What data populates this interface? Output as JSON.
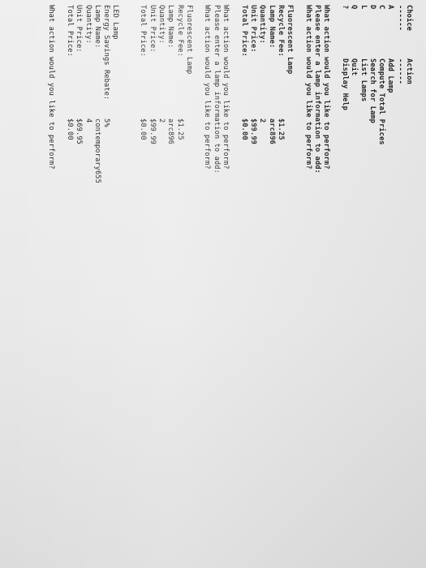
{
  "menu": {
    "header_choice": "Choice",
    "header_action": "Action",
    "underline_choice": "------",
    "underline_action": "------",
    "items": [
      {
        "choice": "A",
        "action": "Add Lamp"
      },
      {
        "choice": "C",
        "action": "Compute Total Prices"
      },
      {
        "choice": "D",
        "action": "Search for Lamp"
      },
      {
        "choice": "L",
        "action": "List Lamps"
      },
      {
        "choice": "Q",
        "action": "Quit"
      },
      {
        "choice": "?",
        "action": "Display Help"
      }
    ]
  },
  "prompts": {
    "what_action": "What action would you like to perform?",
    "enter_lamp": "Please enter a lamp information to add:"
  },
  "lamp1": {
    "type": "Fluorescent Lamp",
    "fields": [
      {
        "label": "Recycle Fee:",
        "value": "$1.25"
      },
      {
        "label": "Lamp Name:",
        "value": "arc896"
      },
      {
        "label": "Quantity:",
        "value": "2"
      },
      {
        "label": "Unit Price:",
        "value": "$99.99"
      },
      {
        "label": "Total Price:",
        "value": "$0.00"
      }
    ]
  },
  "lamp2": {
    "type": "Fluorescent Lamp",
    "fields": [
      {
        "label": "Recycle Fee:",
        "value": "$1.25"
      },
      {
        "label": "Lamp Name:",
        "value": "arc896"
      },
      {
        "label": "Quantity:",
        "value": "2"
      },
      {
        "label": "Unit Price:",
        "value": "$99.99"
      },
      {
        "label": "Total Price:",
        "value": "$0.00"
      }
    ]
  },
  "lamp3": {
    "type": "LED Lamp",
    "fields": [
      {
        "label": "Energy Savings Rebate:",
        "value": "5%"
      },
      {
        "label": "Lamp Name:",
        "value": "contemporary655"
      },
      {
        "label": "Quantity:",
        "value": "4"
      },
      {
        "label": "Unit Price:",
        "value": "$69.95"
      },
      {
        "label": "Total Price:",
        "value": "$0.00"
      }
    ]
  }
}
